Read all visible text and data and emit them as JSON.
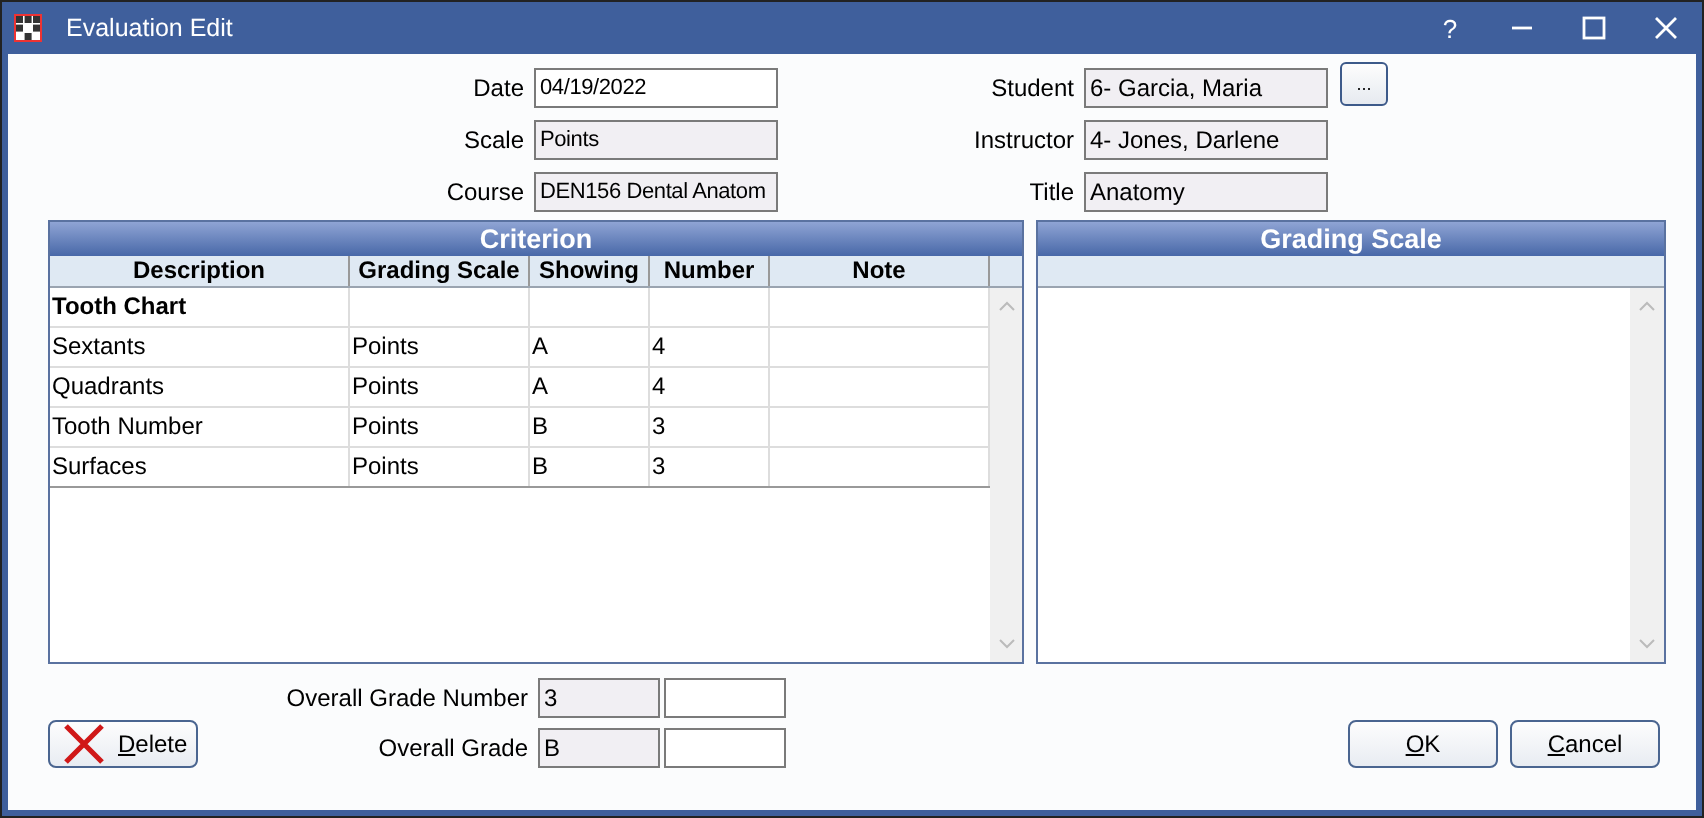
{
  "window": {
    "title": "Evaluation Edit",
    "controls": [
      "?"
    ]
  },
  "fields_left": [
    {
      "label": "Date",
      "value": "04/19/2022",
      "readonly": false
    },
    {
      "label": "Scale",
      "value": "Points",
      "readonly": true
    },
    {
      "label": "Course",
      "value": "DEN156 Dental Anatom",
      "readonly": true
    }
  ],
  "fields_right": [
    {
      "label": "Student",
      "value": "6- Garcia, Maria",
      "readonly": true,
      "picker": "..."
    },
    {
      "label": "Instructor",
      "value": "4- Jones, Darlene",
      "readonly": true
    },
    {
      "label": "Title",
      "value": "Anatomy",
      "readonly": true
    }
  ],
  "criterion": {
    "title": "Criterion",
    "columns": [
      "Description",
      "Grading Scale",
      "Showing",
      "Number",
      "Note"
    ],
    "rows": [
      {
        "kind": "group",
        "cells": [
          "Tooth Chart"
        ]
      },
      {
        "kind": "item",
        "cells": [
          "Sextants",
          "Points",
          "A",
          "4"
        ]
      },
      {
        "kind": "item",
        "cells": [
          "Quadrants",
          "Points",
          "A",
          "4"
        ]
      },
      {
        "kind": "item",
        "cells": [
          "Tooth Number",
          "Points",
          "B",
          "3"
        ]
      },
      {
        "kind": "item",
        "cells": [
          "Surfaces",
          "Points",
          "B",
          "3"
        ]
      }
    ]
  },
  "grading_scale": {
    "title": "Grading Scale"
  },
  "overall": [
    {
      "label": "Overall Grade Number",
      "value": "3"
    },
    {
      "label": "Overall Grade",
      "value": "B"
    }
  ],
  "buttons": {
    "delete": "Delete",
    "ok": "OK",
    "cancel": "Cancel"
  }
}
